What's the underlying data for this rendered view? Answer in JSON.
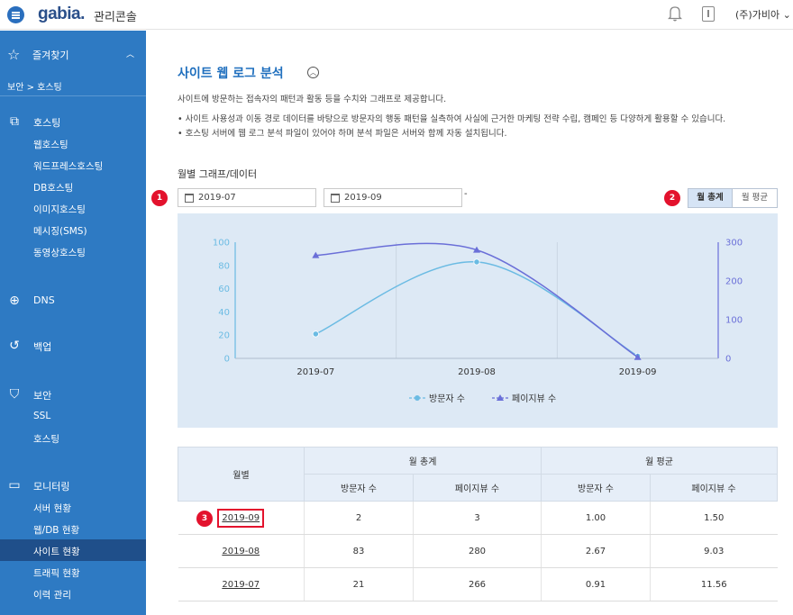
{
  "header": {
    "logo": "gabia.",
    "console_label": "관리콘솔",
    "company": "(주)가비아",
    "company_caret": "⌄"
  },
  "sidebar": {
    "favorites": "즐겨찾기",
    "breadcrumb": "보안 > 호스팅",
    "sections": [
      {
        "label": "호스팅",
        "items": [
          "웹호스팅",
          "워드프레스호스팅",
          "DB호스팅",
          "이미지호스팅",
          "메시징(SMS)",
          "동영상호스팅"
        ]
      },
      {
        "label": "DNS",
        "items": []
      },
      {
        "label": "백업",
        "items": []
      },
      {
        "label": "보안",
        "items": [
          "SSL",
          "호스팅"
        ]
      },
      {
        "label": "모니터링",
        "items": [
          "서버 현황",
          "웹/DB 현황",
          "사이트 현황",
          "트래픽 현황",
          "이력 관리"
        ]
      }
    ],
    "active_item": "사이트 현황"
  },
  "main": {
    "title": "사이트 웹 로그 분석",
    "description": "사이트에 방문하는 접속자의 패턴과 활동 등을 수치와 그래프로 제공합니다.",
    "bullets": [
      "사이트 사용성과 이동 경로 데이터를 바탕으로 방문자의 행동 패턴을 실측하여 사실에 근거한 마케팅 전략 수립, 캠페인 등 다양하게 활용할 수 있습니다.",
      "호스팅 서버에 웹 로그 분석 파일이 있어야 하며 분석 파일은 서버와 함께 자동 설치됩니다."
    ],
    "section_title": "월별 그래프/데이터",
    "start_date": "2019-07",
    "end_date": "2019-09",
    "date_separator": "-",
    "toggle_total": "월 총계",
    "toggle_avg": "월 평균",
    "badges": [
      "1",
      "2",
      "3"
    ]
  },
  "chart_data": {
    "type": "line",
    "categories": [
      "2019-07",
      "2019-08",
      "2019-09"
    ],
    "series": [
      {
        "name": "방문자 수",
        "axis": "left",
        "values": [
          21,
          83,
          2
        ],
        "color": "#6bbbe3",
        "marker": "circle"
      },
      {
        "name": "페이지뷰 수",
        "axis": "right",
        "values": [
          266,
          280,
          3
        ],
        "color": "#6a6fd8",
        "marker": "triangle"
      }
    ],
    "y_left": {
      "min": 0,
      "max": 100,
      "ticks": [
        0,
        20,
        40,
        60,
        80,
        100
      ]
    },
    "y_right": {
      "min": 0,
      "max": 300,
      "ticks": [
        0,
        100,
        200,
        300
      ]
    },
    "grid": true,
    "legend": "bottom"
  },
  "table": {
    "month_header": "월별",
    "group_total": "월 총계",
    "group_avg": "월 평균",
    "sub_headers": [
      "방문자 수",
      "페이지뷰 수",
      "방문자 수",
      "페이지뷰 수"
    ],
    "rows": [
      {
        "month": "2019-09",
        "cells": [
          "2",
          "3",
          "1.00",
          "1.50"
        ]
      },
      {
        "month": "2019-08",
        "cells": [
          "83",
          "280",
          "2.67",
          "9.03"
        ]
      },
      {
        "month": "2019-07",
        "cells": [
          "21",
          "266",
          "0.91",
          "11.56"
        ]
      }
    ]
  }
}
